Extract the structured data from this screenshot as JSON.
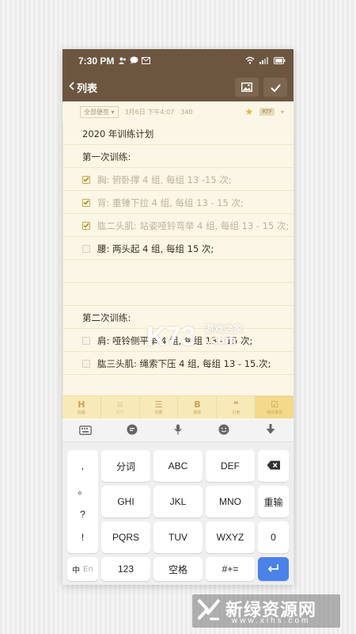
{
  "status": {
    "time": "7:30 PM"
  },
  "toolbar": {
    "back_label": "列表"
  },
  "meta": {
    "folder": "全部便签",
    "date": "3月6日 下午4:07",
    "count": "340",
    "format": "RTF"
  },
  "note": {
    "title": "2020 年训练计划",
    "section1": "第一次训练:",
    "items1": [
      {
        "text": "胸: 俯卧撑 4 组, 每组 13 -15 次;",
        "checked": true
      },
      {
        "text": "背: 重锤下拉 4 组, 每组 13 - 15 次;",
        "checked": true
      },
      {
        "text": "肱二头肌: 站姿哑铃弯举 4 组, 每组 13 - 15 次;",
        "checked": true
      },
      {
        "text": "腰: 两头起 4 组, 每组 15 次;",
        "checked": false
      }
    ],
    "section2": "第二次训练:",
    "items2": [
      {
        "text": "肩: 哑铃侧平举 4 组, 每组 13 - 15 次;",
        "checked": false
      },
      {
        "text": "肱三头肌: 绳索下压 4 组, 每组 13 - 15.次;",
        "checked": false
      }
    ]
  },
  "watermark": {
    "logo": "K73",
    "text": "游戏之家",
    "domain": ".com"
  },
  "formatbar": {
    "items": [
      {
        "glyph": "H",
        "label": "标题"
      },
      {
        "glyph": "≡",
        "label": "编号"
      },
      {
        "glyph": "☰",
        "label": "列表"
      },
      {
        "glyph": "B",
        "label": "粗体"
      },
      {
        "glyph": "❝",
        "label": "引用"
      },
      {
        "glyph": "☑",
        "label": "待办事项"
      }
    ]
  },
  "keyboard": {
    "side_keys": [
      ",",
      "。",
      "?",
      "!"
    ],
    "row1": [
      "分词",
      "ABC",
      "DEF"
    ],
    "row2": [
      "GHI",
      "JKL",
      "MNO",
      "重输"
    ],
    "row3": [
      "PQRS",
      "TUV",
      "WXYZ",
      "0"
    ],
    "lang_zh": "中",
    "lang_en": "En",
    "num_key": "123",
    "space_key": "空格",
    "symbol_key": "#+="
  },
  "brand": {
    "name": "新绿资源网",
    "domain": "www.xlhs.com"
  },
  "colors": {
    "header": "#6d5640",
    "accent": "#4a82e8",
    "checkbox": "#c9a84a"
  }
}
